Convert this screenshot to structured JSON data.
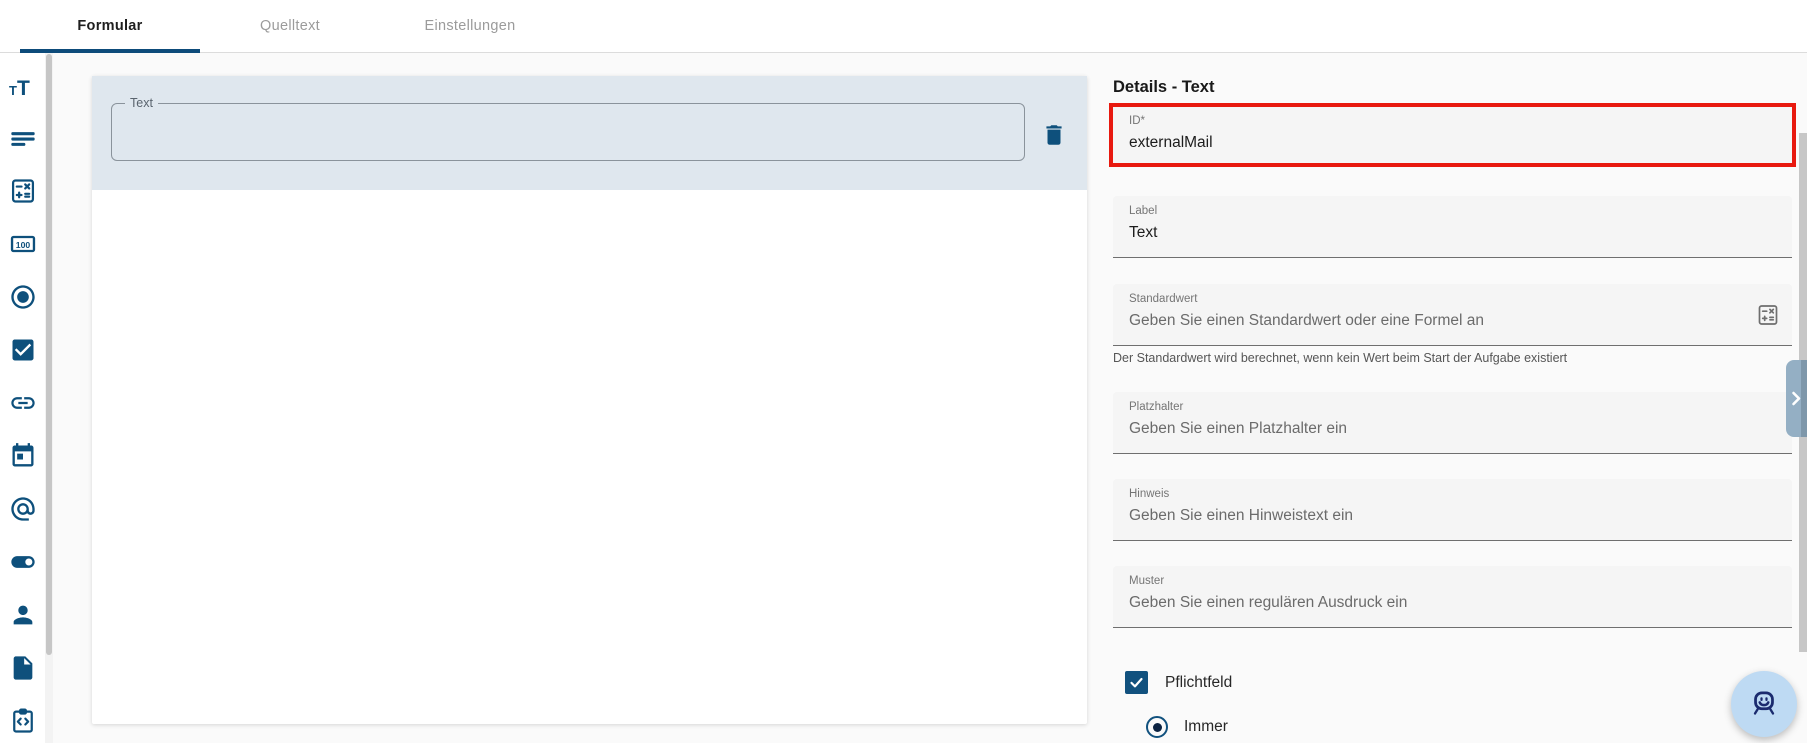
{
  "topbar": {
    "tabs": [
      {
        "label": "Formular",
        "active": true
      },
      {
        "label": "Quelltext",
        "active": false
      },
      {
        "label": "Einstellungen",
        "active": false
      }
    ]
  },
  "sidebar": {
    "icons": [
      "text-icon",
      "paragraph-icon",
      "calculator-icon",
      "number-icon",
      "radio-icon",
      "checkbox-icon",
      "link-icon",
      "calendar-icon",
      "email-icon",
      "toggle-icon",
      "user-icon",
      "file-icon",
      "checklist-code-icon"
    ],
    "text_icon_small": "T",
    "text_icon_big": "T",
    "number_icon_text": "100"
  },
  "canvas": {
    "component": {
      "label": "Text"
    }
  },
  "details": {
    "title": "Details - Text",
    "id_field": {
      "label": "ID*",
      "value": "externalMail"
    },
    "label_field": {
      "label": "Label",
      "value": "Text"
    },
    "default_field": {
      "label": "Standardwert",
      "placeholder": "Geben Sie einen Standardwert oder eine Formel an",
      "helper": "Der Standardwert wird berechnet, wenn kein Wert beim Start der Aufgabe existiert"
    },
    "placeholder_field": {
      "label": "Platzhalter",
      "placeholder": "Geben Sie einen Platzhalter ein"
    },
    "hint_field": {
      "label": "Hinweis",
      "placeholder": "Geben Sie einen Hinweistext ein"
    },
    "pattern_field": {
      "label": "Muster",
      "placeholder": "Geben Sie einen regulären Ausdruck ein"
    },
    "required_checkbox": {
      "label": "Pflichtfeld",
      "checked": true
    },
    "required_condition_radio": {
      "label": "Immer",
      "selected": true
    }
  },
  "colors": {
    "primary_blue": "#0e507c",
    "selection_bg": "#dfe7ee",
    "annotation_red": "#e8190f",
    "fab_bg": "#bedaf3",
    "fab_icon": "#1b2b6e",
    "expand_tab": "#94afc4",
    "field_bg": "#f5f5f5"
  }
}
